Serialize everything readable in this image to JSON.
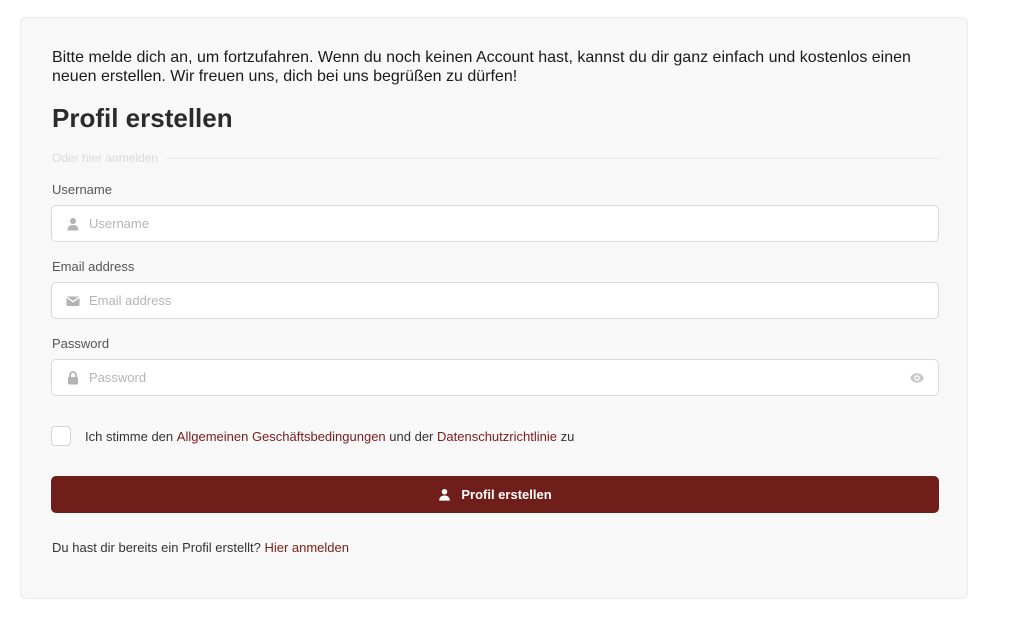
{
  "intro_text": "Bitte melde dich an, um fortzufahren. Wenn du noch keinen Account hast, kannst du dir ganz einfach und kostenlos einen neuen erstellen. Wir freuen uns, dich bei uns begrüßen zu dürfen!",
  "title": "Profil erstellen",
  "divider_label": "Oder hier anmelden",
  "fields": {
    "username": {
      "label": "Username",
      "placeholder": "Username",
      "value": "",
      "icon": "user-icon"
    },
    "email": {
      "label": "Email address",
      "placeholder": "Email address",
      "value": "",
      "icon": "envelope-icon"
    },
    "password": {
      "label": "Password",
      "placeholder": "Password",
      "value": "",
      "icon": "lock-icon",
      "toggle_icon": "eye-icon"
    }
  },
  "terms": {
    "checked": false,
    "prefix": "Ich stimme den",
    "terms_link": "Allgemeinen Geschäftsbedingungen",
    "middle": "und der",
    "privacy_link": "Datenschutzrichtlinie",
    "suffix": "zu"
  },
  "submit": {
    "label": "Profil erstellen",
    "icon": "user-icon"
  },
  "login": {
    "prompt": "Du hast dir bereits ein Profil erstellt?",
    "link": "Hier anmelden"
  },
  "colors": {
    "accent": "#6f1e1a",
    "link": "#7a1c1c",
    "card_background": "#f8f8f8",
    "icon_gray": "#b3b3b3"
  }
}
